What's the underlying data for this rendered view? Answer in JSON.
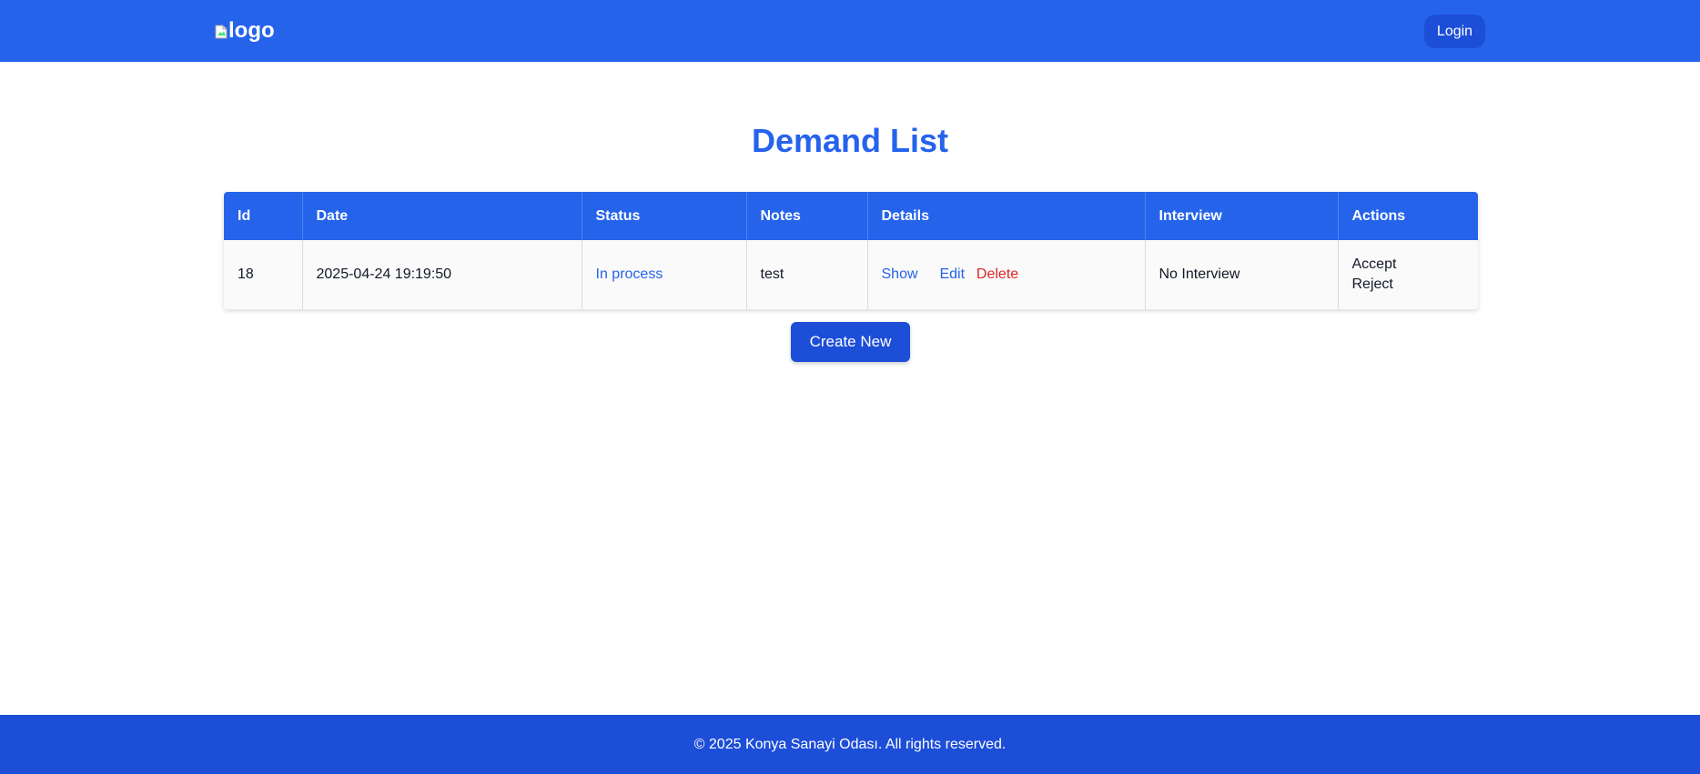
{
  "header": {
    "logo_alt": "logo",
    "login_label": "Login"
  },
  "page": {
    "title": "Demand List"
  },
  "table": {
    "columns": [
      "Id",
      "Date",
      "Status",
      "Notes",
      "Details",
      "Interview",
      "Actions"
    ],
    "rows": [
      {
        "id": "18",
        "date": "2025-04-24 19:19:50",
        "status": "In process",
        "notes": "test",
        "details": {
          "show": "Show",
          "edit": "Edit",
          "delete": "Delete"
        },
        "interview": "No Interview",
        "actions": {
          "accept": "Accept",
          "reject": "Reject"
        }
      }
    ]
  },
  "create_button_label": "Create New",
  "footer": {
    "text": "© 2025 Konya Sanayi Odası. All rights reserved."
  },
  "colors": {
    "primary": "#2563eb",
    "primary_dark": "#1d4ed8",
    "danger": "#dc2626"
  }
}
